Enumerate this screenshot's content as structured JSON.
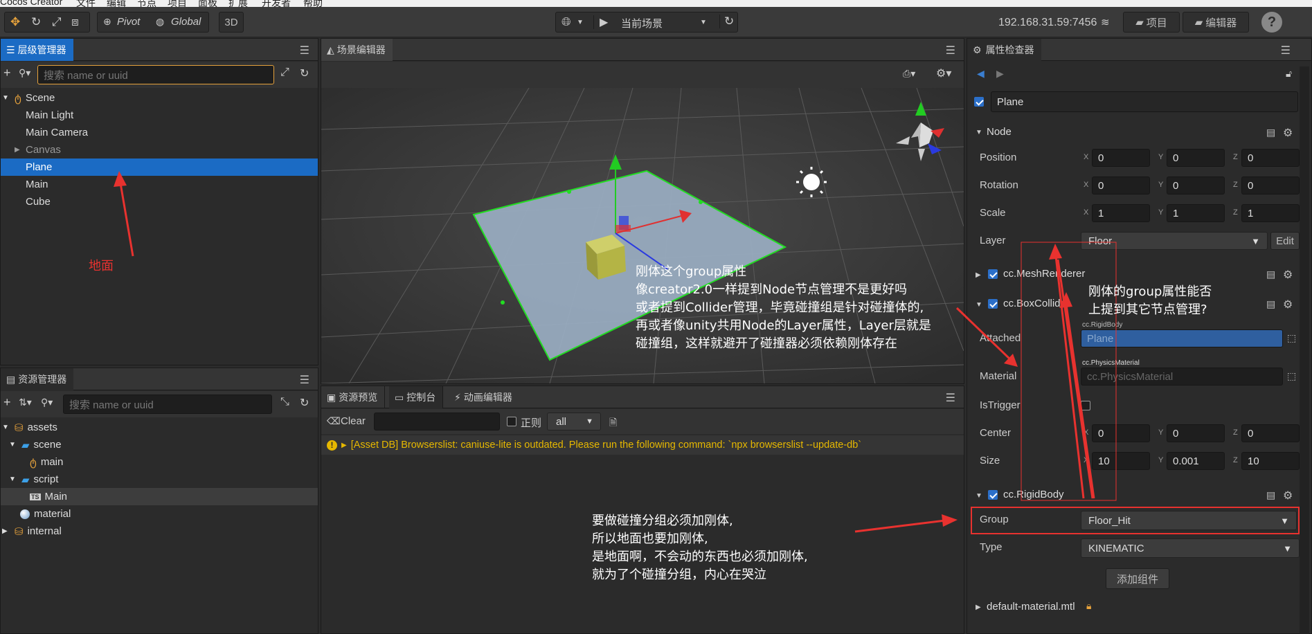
{
  "menubar": {
    "items": [
      "Cocos Creator",
      "文件",
      "编辑",
      "节点",
      "项目",
      "面板",
      "扩展",
      "开发者",
      "帮助"
    ]
  },
  "toolbar": {
    "pivot_label": "Pivot",
    "global_label": "Global",
    "mode_3d_label": "3D",
    "scene_select": "当前场景",
    "ip_address": "192.168.31.59:7456",
    "project_label": "项目",
    "editor_label": "编辑器",
    "help_label": "?"
  },
  "hierarchy": {
    "title": "层级管理器",
    "search_placeholder": "搜索 name or uuid",
    "items": [
      "Scene",
      "Main Light",
      "Main Camera",
      "Canvas",
      "Plane",
      "Main",
      "Cube"
    ]
  },
  "assets": {
    "title": "资源管理器",
    "search_placeholder": "搜索 name or uuid",
    "items": [
      "assets",
      "scene",
      "main",
      "script",
      "Main",
      "material",
      "internal"
    ]
  },
  "scene_editor": {
    "title": "场景编辑器"
  },
  "console": {
    "tabs": [
      "资源预览",
      "控制台",
      "动画编辑器"
    ],
    "clear_label": "Clear",
    "regex_label": "正则",
    "filter_value": "all",
    "message": "[Asset DB] Browserslist: caniuse-lite is outdated. Please run the following command: `npx browserslist --update-db`"
  },
  "inspector": {
    "title": "属性检查器",
    "node_name": "Plane",
    "node_section": "Node",
    "position_label": "Position",
    "rotation_label": "Rotation",
    "scale_label": "Scale",
    "layer_label": "Layer",
    "position": {
      "x": "0",
      "y": "0",
      "z": "0"
    },
    "rotation": {
      "x": "0",
      "y": "0",
      "z": "0"
    },
    "scale": {
      "x": "1",
      "y": "1",
      "z": "1"
    },
    "axis_x": "X",
    "axis_y": "Y",
    "axis_z": "Z",
    "layer": "Floor",
    "edit_label": "Edit",
    "mesh_renderer": "cc.MeshRenderer",
    "box_collider": "cc.BoxCollider",
    "attached_label": "Attached",
    "attached_tag": "cc.RigidBody",
    "attached_value": "Plane",
    "material_label": "Material",
    "material_tag": "cc.PhysicsMaterial",
    "material_value": "cc.PhysicsMaterial",
    "is_trigger_label": "IsTrigger",
    "center_label": "Center",
    "size_label": "Size",
    "center": {
      "x": "0",
      "y": "0",
      "z": "0"
    },
    "size": {
      "x": "10",
      "y": "0.001",
      "z": "10"
    },
    "rigid_body": "cc.RigidBody",
    "group_label": "Group",
    "group_value": "Floor_Hit",
    "type_label": "Type",
    "type_value": "KINEMATIC",
    "add_component": "添加组件",
    "default_material": "default-material.mtl"
  },
  "annotations": {
    "ground": "地面",
    "scene_note": [
      "刚体这个group属性",
      "像creator2.0一样提到Node节点管理不是更好吗",
      "或者提到Collider管理，毕竟碰撞组是针对碰撞体的,",
      "再或者像unity共用Node的Layer属性，Layer层就是",
      "碰撞组，这样就避开了碰撞器必须依赖刚体存在"
    ],
    "inspector_note": [
      "刚体的group属性能否",
      "上提到其它节点管理?"
    ],
    "console_note": [
      "要做碰撞分组必须加刚体,",
      "所以地面也要加刚体,",
      "是地面啊，不会动的东西也必须加刚体,",
      "就为了个碰撞分组，内心在哭泣"
    ]
  },
  "colors": {
    "selection": "#1b6bc4",
    "annotation_red": "#e8322f",
    "warning": "#e6b800",
    "grid_green": "#22dd22"
  }
}
